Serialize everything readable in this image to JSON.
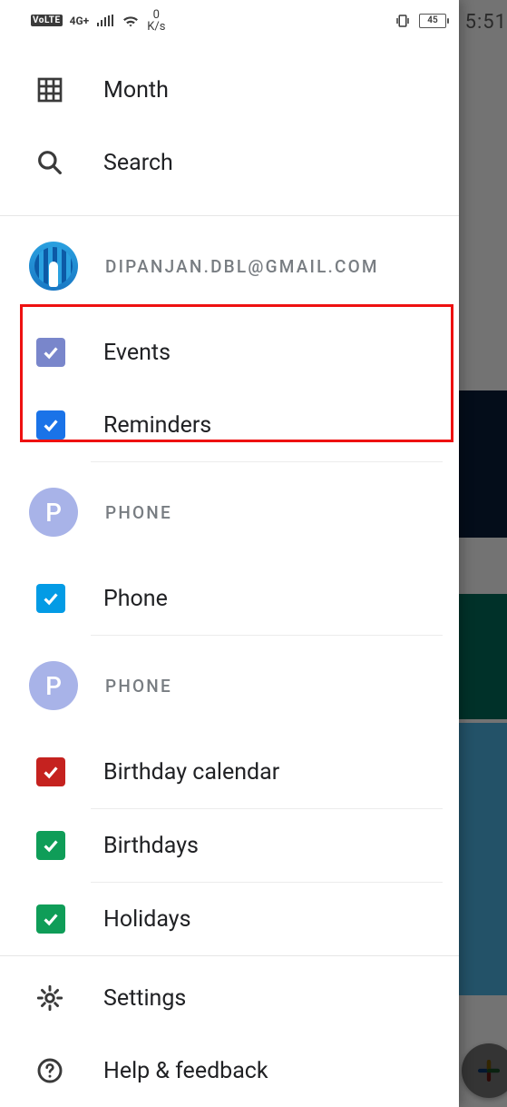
{
  "statusbar": {
    "volte": "VoLTE",
    "network": "4G+",
    "data_rate_top": "0",
    "data_rate_bottom": "K/s",
    "battery": "45",
    "time": "5:51"
  },
  "nav": {
    "month": "Month",
    "search": "Search"
  },
  "accounts": [
    {
      "id": "gmail",
      "avatar_type": "photo",
      "avatar_letter": "",
      "email": "DIPANJAN.DBL@GMAIL.COM",
      "calendars": [
        {
          "id": "events",
          "label": "Events",
          "color": "#7986cb",
          "checked": true
        },
        {
          "id": "reminders",
          "label": "Reminders",
          "color": "#1a73e8",
          "checked": true
        }
      ]
    },
    {
      "id": "phone1",
      "avatar_type": "letter",
      "avatar_letter": "P",
      "email": "PHONE",
      "calendars": [
        {
          "id": "phone",
          "label": "Phone",
          "color": "#039be5",
          "checked": true
        }
      ]
    },
    {
      "id": "phone2",
      "avatar_type": "letter",
      "avatar_letter": "P",
      "email": "PHONE",
      "calendars": [
        {
          "id": "birthday-cal",
          "label": "Birthday calendar",
          "color": "#c5221f",
          "checked": true
        },
        {
          "id": "birthdays",
          "label": "Birthdays",
          "color": "#0f9d58",
          "checked": true
        },
        {
          "id": "holidays",
          "label": "Holidays",
          "color": "#0f9d58",
          "checked": true
        }
      ]
    }
  ],
  "footer": {
    "settings": "Settings",
    "help": "Help & feedback"
  },
  "highlight": {
    "visible": true
  }
}
